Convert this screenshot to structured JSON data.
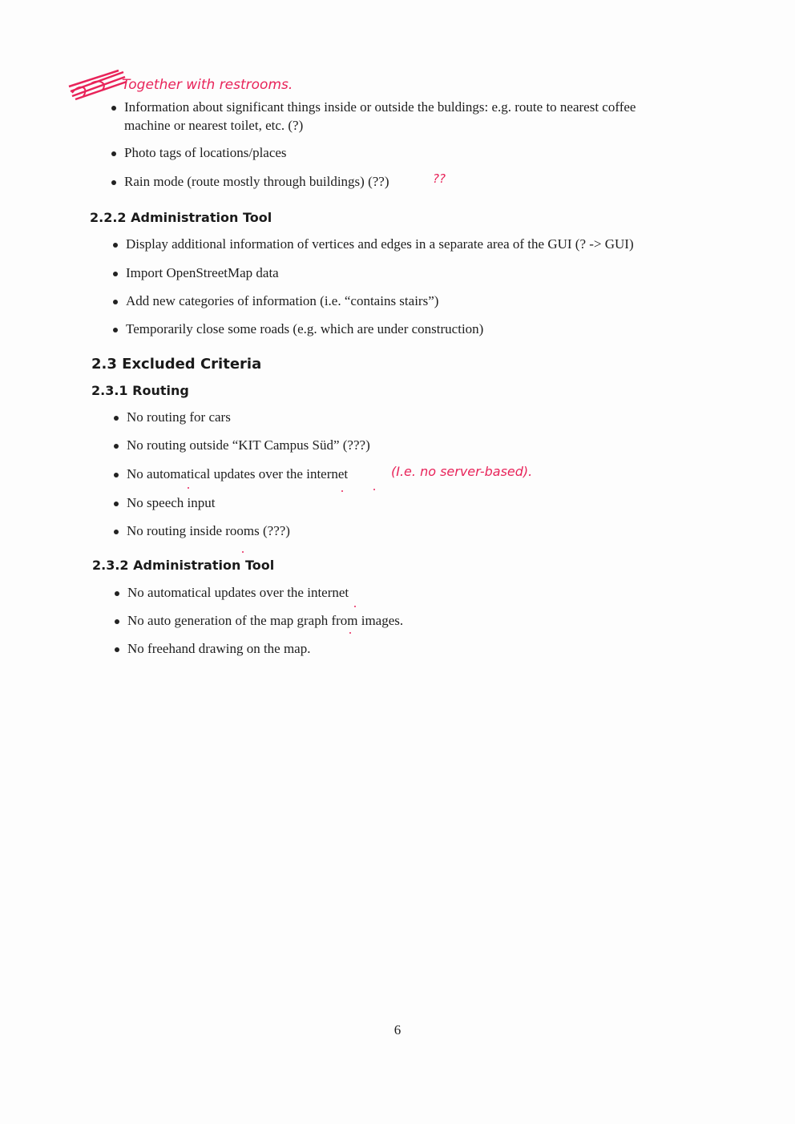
{
  "annotations": {
    "together": "Together with restrooms.",
    "qq": "??",
    "ie": "(I.e.  no  server-based)."
  },
  "section_222": {
    "heading": "2.2.2 Administration Tool",
    "items": [
      "Display additional information of vertices and edges in a separate area of the GUI (? -> GUI)",
      "Import OpenStreetMap data",
      "Add new categories of information (i.e. “contains stairs”)",
      "Temporarily close some roads (e.g. which are under construction)"
    ]
  },
  "top_list": {
    "items": [
      "Information about significant things inside or outside the buldings: e.g. route to nearest coffee",
      "machine or nearest toilet, etc. (?)",
      "Photo tags of locations/places",
      "Rain mode (route mostly through buildings) (??)"
    ]
  },
  "section_23": {
    "heading": "2.3  Excluded Criteria"
  },
  "section_231": {
    "heading": "2.3.1 Routing",
    "items": [
      "No routing for cars",
      "No routing outside “KIT Campus Süd” (???)",
      "No automatical updates over the internet",
      "No speech input",
      "No routing inside rooms (???)"
    ]
  },
  "section_232": {
    "heading": "2.3.2 Administration Tool",
    "items": [
      "No automatical updates over the internet",
      "No auto generation of the map graph from images.",
      "No freehand drawing on the map."
    ]
  },
  "page_number": "6"
}
